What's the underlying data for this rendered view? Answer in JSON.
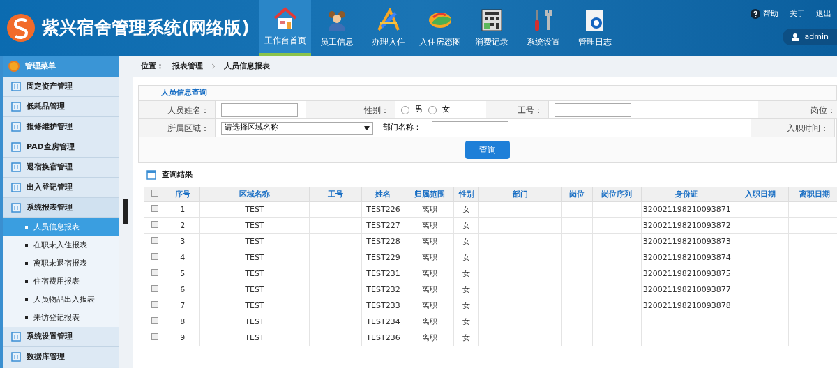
{
  "header": {
    "title": "紫兴宿舍管理系统(网络版)",
    "nav": [
      {
        "label": "工作台首页",
        "selected": true,
        "kind": "home"
      },
      {
        "label": "员工信息",
        "selected": false,
        "kind": "people"
      },
      {
        "label": "办理入住",
        "selected": false,
        "kind": "tools"
      },
      {
        "label": "入住房态图",
        "selected": false,
        "kind": "chart"
      },
      {
        "label": "消费记录",
        "selected": false,
        "kind": "calc"
      },
      {
        "label": "系统设置",
        "selected": false,
        "kind": "wrench"
      },
      {
        "label": "管理日志",
        "selected": false,
        "kind": "log"
      }
    ],
    "links": [
      "帮助",
      "关于",
      "退出"
    ],
    "user": "admin"
  },
  "sidebar": {
    "title": "管理菜单",
    "items": [
      {
        "label": "固定资产管理",
        "expanded": false
      },
      {
        "label": "低耗品管理",
        "expanded": false
      },
      {
        "label": "报修维护管理",
        "expanded": false
      },
      {
        "label": "PAD查房管理",
        "expanded": false
      },
      {
        "label": "退宿换宿管理",
        "expanded": false
      },
      {
        "label": "出入登记管理",
        "expanded": false
      },
      {
        "label": "系统报表管理",
        "expanded": true,
        "children": [
          {
            "label": "人员信息报表",
            "selected": true
          },
          {
            "label": "在职未入住报表",
            "selected": false
          },
          {
            "label": "离职未退宿报表",
            "selected": false
          },
          {
            "label": "住宿费用报表",
            "selected": false
          },
          {
            "label": "人员物品出入报表",
            "selected": false
          },
          {
            "label": "来访登记报表",
            "selected": false
          }
        ]
      },
      {
        "label": "系统设置管理",
        "expanded": false
      },
      {
        "label": "数据库管理",
        "expanded": false
      }
    ]
  },
  "breadcrumb": {
    "label": "位置：",
    "path": [
      "报表管理",
      "人员信息报表"
    ]
  },
  "query": {
    "title": "人员信息查询",
    "name_label": "人员姓名：",
    "gender_label": "性别：",
    "genders": [
      {
        "label": "男",
        "selected": false
      },
      {
        "label": "女",
        "selected": false
      }
    ],
    "id_label": "工号：",
    "post_label": "岗位：",
    "area_label": "所属区域：",
    "area_value": "请选择区域名称",
    "dept_label": "部门名称：",
    "date_label": "入职时间：",
    "button": "查询"
  },
  "results": {
    "title": "查询结果",
    "all_checked": false,
    "columns": [
      "序号",
      "区域名称",
      "工号",
      "姓名",
      "归属范围",
      "性别",
      "部门",
      "岗位",
      "岗位序列",
      "身份证",
      "入职日期",
      "离职日期"
    ],
    "rows": [
      {
        "checked": false,
        "cells": [
          "1",
          "TEST",
          "",
          "TEST226",
          "离职",
          "女",
          "",
          "",
          "",
          "320021198210093871",
          "",
          ""
        ]
      },
      {
        "checked": false,
        "cells": [
          "2",
          "TEST",
          "",
          "TEST227",
          "离职",
          "女",
          "",
          "",
          "",
          "320021198210093872",
          "",
          ""
        ]
      },
      {
        "checked": false,
        "cells": [
          "3",
          "TEST",
          "",
          "TEST228",
          "离职",
          "女",
          "",
          "",
          "",
          "320021198210093873",
          "",
          ""
        ]
      },
      {
        "checked": false,
        "cells": [
          "4",
          "TEST",
          "",
          "TEST229",
          "离职",
          "女",
          "",
          "",
          "",
          "320021198210093874",
          "",
          ""
        ]
      },
      {
        "checked": false,
        "cells": [
          "5",
          "TEST",
          "",
          "TEST231",
          "离职",
          "女",
          "",
          "",
          "",
          "320021198210093875",
          "",
          ""
        ]
      },
      {
        "checked": false,
        "cells": [
          "6",
          "TEST",
          "",
          "TEST232",
          "离职",
          "女",
          "",
          "",
          "",
          "320021198210093877",
          "",
          ""
        ]
      },
      {
        "checked": false,
        "cells": [
          "7",
          "TEST",
          "",
          "TEST233",
          "离职",
          "女",
          "",
          "",
          "",
          "320021198210093878",
          "",
          ""
        ]
      },
      {
        "checked": false,
        "cells": [
          "8",
          "TEST",
          "",
          "TEST234",
          "离职",
          "女",
          "",
          "",
          "",
          "",
          "",
          ""
        ]
      },
      {
        "checked": false,
        "cells": [
          "9",
          "TEST",
          "",
          "TEST236",
          "离职",
          "女",
          "",
          "",
          "",
          "",
          "",
          ""
        ]
      }
    ]
  }
}
